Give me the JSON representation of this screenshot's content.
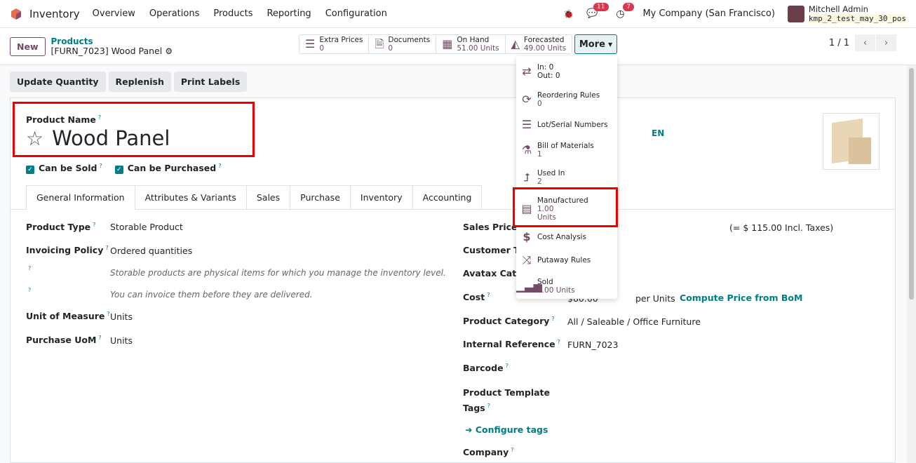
{
  "nav": {
    "app": "Inventory",
    "menu": [
      "Overview",
      "Operations",
      "Products",
      "Reporting",
      "Configuration"
    ],
    "messages_count": "11",
    "activities_count": "7",
    "company": "My Company (San Francisco)",
    "user": "Mitchell Admin",
    "db": "kmp_2_test_may_30_pos"
  },
  "control": {
    "new": "New",
    "breadcrumb_parent": "Products",
    "breadcrumb_current": "[FURN_7023] Wood Panel",
    "pager": "1 / 1",
    "more": "More",
    "stats": [
      {
        "label": "Extra Prices",
        "value": "0",
        "icon": "list-icon"
      },
      {
        "label": "Documents",
        "value": "0",
        "icon": "document-icon"
      },
      {
        "label": "On Hand",
        "value": "51.00 Units",
        "icon": "cubes-icon"
      },
      {
        "label": "Forecasted",
        "value": "49.00 Units",
        "icon": "area-chart-icon"
      }
    ]
  },
  "more_menu": [
    {
      "label": "In: 0",
      "value": "Out: 0",
      "icon": "exchange-icon"
    },
    {
      "label": "Reordering Rules",
      "value": "0",
      "icon": "refresh-icon"
    },
    {
      "label": "Lot/Serial Numbers",
      "value": "",
      "icon": "bars-icon"
    },
    {
      "label": "Bill of Materials",
      "value": "1",
      "icon": "flask-icon"
    },
    {
      "label": "Used In",
      "value": "2",
      "icon": "level-up-icon"
    },
    {
      "label": "Manufactured",
      "value": "1.00",
      "value2": "Units",
      "icon": "list-alt-icon"
    },
    {
      "label": "Cost Analysis",
      "value": "",
      "icon": "dollar-icon"
    },
    {
      "label": "Putaway Rules",
      "value": "",
      "icon": "random-icon"
    },
    {
      "label": "Sold",
      "value": "0.00 Units",
      "icon": "signal-icon"
    }
  ],
  "actions": [
    "Update Quantity",
    "Replenish",
    "Print Labels"
  ],
  "form": {
    "name_label": "Product Name",
    "name": "Wood Panel",
    "lang": "EN",
    "can_be_sold": "Can be Sold",
    "can_be_purchased": "Can be Purchased",
    "tabs": [
      "General Information",
      "Attributes & Variants",
      "Sales",
      "Purchase",
      "Inventory",
      "Accounting"
    ],
    "product_type_label": "Product Type",
    "product_type": "Storable Product",
    "invoicing_label": "Invoicing Policy",
    "invoicing": "Ordered quantities",
    "help1": "Storable products are physical items for which you manage the inventory level.",
    "help2": "You can invoice them before they are delivered.",
    "uom_label": "Unit of Measure",
    "uom": "Units",
    "puom_label": "Purchase UoM",
    "puom": "Units",
    "sales_price_label": "Sales Price",
    "incl_taxes": "(= $ 115.00 Incl. Taxes)",
    "customer_tax_label": "Customer Taxes",
    "avatax_label": "Avatax Category",
    "cost_label": "Cost",
    "cost": "$80.00",
    "per_units": "per Units",
    "compute_bom": "Compute Price from BoM",
    "category_label": "Product Category",
    "category": "All / Saleable / Office Furniture",
    "ref_label": "Internal Reference",
    "ref": "FURN_7023",
    "barcode_label": "Barcode",
    "tags_label1": "Product Template",
    "tags_label2": "Tags",
    "configure_tags": "Configure tags",
    "company_label": "Company"
  }
}
